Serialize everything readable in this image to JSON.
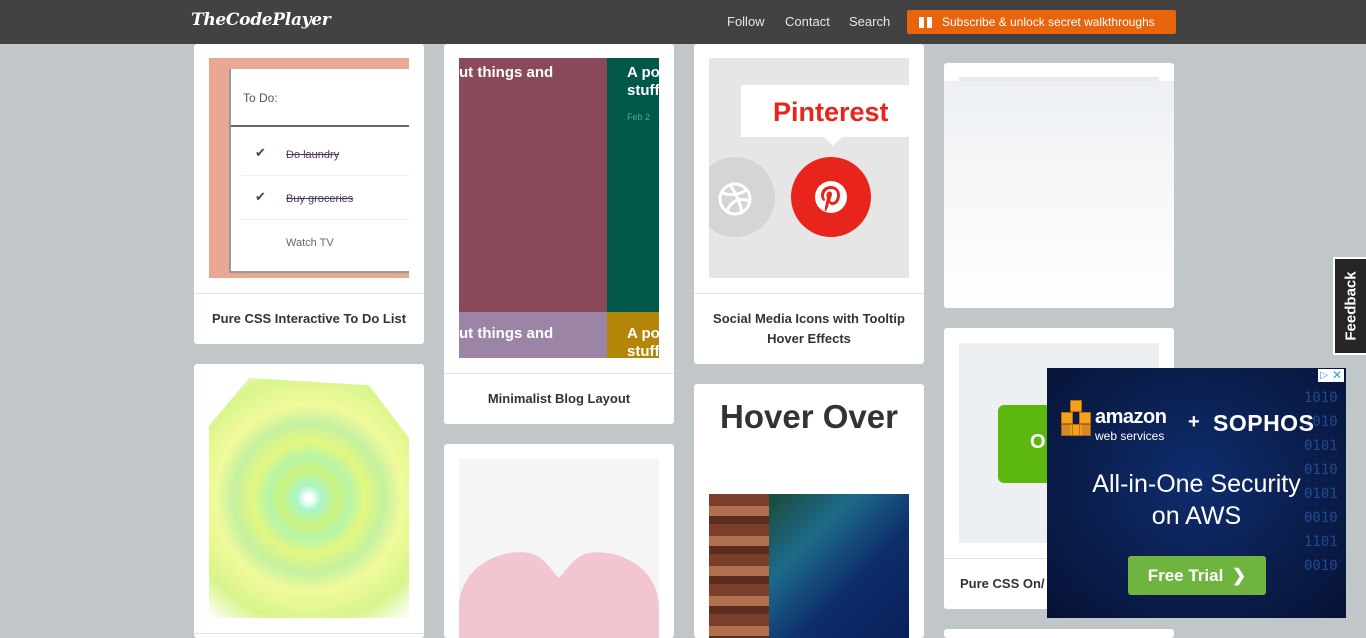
{
  "header": {
    "brand": "TheCodePlayer",
    "nav": [
      {
        "label": "Follow"
      },
      {
        "label": "Contact"
      },
      {
        "label": "Search"
      }
    ],
    "subscribe_label": "Subscribe & unlock secret walkthroughs",
    "colors": {
      "bar": "#424242",
      "accent": "#e8650e"
    }
  },
  "cards": {
    "todo": {
      "caption": "Pure CSS Interactive To Do List",
      "heading": "To Do:",
      "items": [
        {
          "label": "Do laundry",
          "done": true
        },
        {
          "label": "Buy groceries",
          "done": true
        },
        {
          "label": "Watch TV",
          "done": false
        }
      ]
    },
    "blog": {
      "caption": "Minimalist Blog Layout",
      "text_top_left": "ut things and",
      "text_top_right": "A po",
      "text_top_right_2": "stuff",
      "date": "Feb 2",
      "text_bottom_left": "ut things and",
      "text_bottom_right": "A po",
      "text_bottom_right_2": "stuff"
    },
    "social": {
      "caption_line1": "Social Media Icons with Tooltip",
      "caption_line2": "Hover Effects",
      "tooltip": "Pinterest"
    },
    "hover": {
      "title": "Hover Over"
    },
    "toggle": {
      "caption": "Pure CSS On/",
      "button_text": "O"
    }
  },
  "feedback_label": "Feedback",
  "ad": {
    "brand1": "amazon",
    "brand1_sub": "web services",
    "plus": "+",
    "brand2": "SOPHOS",
    "headline_line1": "All-in-One Security",
    "headline_line2": "on AWS",
    "cta": "Free Trial",
    "cta_chevron": "❯",
    "close": "✕",
    "adchoices": "▷",
    "digits": "10101010010101100101001011010010"
  }
}
